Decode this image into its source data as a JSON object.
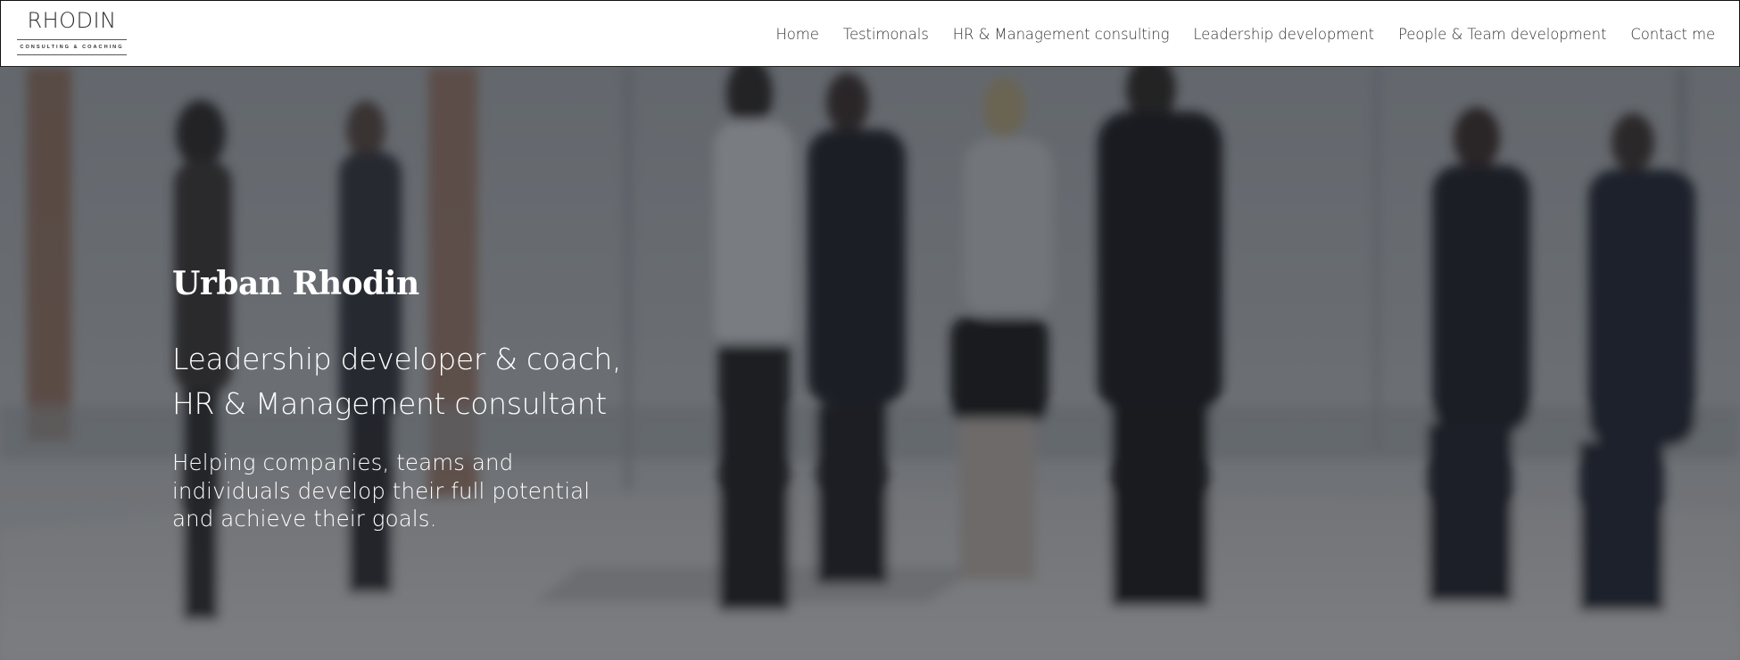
{
  "brand": {
    "name": "RHODIN",
    "tagline": "CONSULTING & COACHING"
  },
  "nav": {
    "items": [
      {
        "label": "Home"
      },
      {
        "label": "Testimonals"
      },
      {
        "label": "HR & Management consulting"
      },
      {
        "label": "Leadership development"
      },
      {
        "label": "People & Team development"
      },
      {
        "label": "Contact me"
      }
    ]
  },
  "hero": {
    "title": "Urban Rhodin",
    "subtitle_lines": [
      "Leadership developer & coach,",
      "HR & Management consultant"
    ],
    "description_lines": [
      "Helping companies, teams and",
      "individuals develop their full potential",
      "and achieve their goals."
    ],
    "background_image": "blurred-office-people-photo"
  },
  "colors": {
    "header_bg": "#ffffff",
    "nav_text": "#333333",
    "hero_text": "#ffffff",
    "overlay": "#1e2026"
  }
}
